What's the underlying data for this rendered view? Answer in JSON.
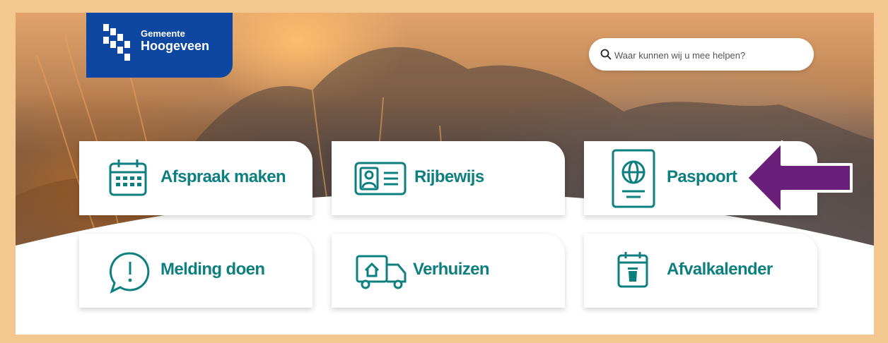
{
  "header": {
    "logo": {
      "line1": "Gemeente",
      "line2": "Hoogeveen"
    },
    "search": {
      "placeholder": "Waar kunnen wij u mee helpen?",
      "value": ""
    }
  },
  "tiles": [
    {
      "label": "Afspraak maken",
      "icon": "calendar-icon"
    },
    {
      "label": "Rijbewijs",
      "icon": "id-card-icon"
    },
    {
      "label": "Paspoort",
      "icon": "passport-icon"
    },
    {
      "label": "Melding doen",
      "icon": "exclamation-bubble-icon"
    },
    {
      "label": "Verhuizen",
      "icon": "moving-truck-icon"
    },
    {
      "label": "Afvalkalender",
      "icon": "waste-calendar-icon"
    }
  ],
  "annotation": {
    "icon": "arrow-left-icon",
    "color": "#6a1f7a"
  },
  "colors": {
    "frame": "#f4c690",
    "brand_blue": "#0d47a1",
    "teal": "#0e7f7f"
  }
}
